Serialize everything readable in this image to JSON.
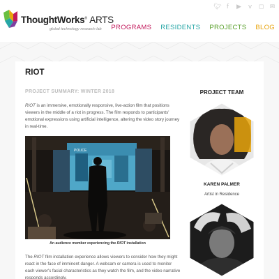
{
  "brand": {
    "name": "ThoughtWorks",
    "suffix": "ARTS",
    "tagline": "global technology research lab"
  },
  "social_icons": [
    "twitter-icon",
    "facebook-icon",
    "youtube-icon",
    "vimeo-icon",
    "instagram-icon",
    "email-icon"
  ],
  "nav": {
    "programs": "PROGRAMS",
    "residents": "RESIDENTS",
    "projects": "PROJECTS",
    "blog": "BLOG"
  },
  "colors": {
    "programs": "#c2185b",
    "residents": "#26a6a6",
    "projects": "#5aa02c",
    "blog": "#e8a40c"
  },
  "project": {
    "title": "RIOT",
    "summary_label": "PROJECT SUMMARY: WINTER 2018",
    "intro_em": "RIOT",
    "intro_rest": " is an immersive, emotionally responsive, live-action film that positions viewers in the middle of a riot in progress. The film responds to participants' emotional expressions using artificial intelligence, altering the video story journey in real-time.",
    "photo_sign": "POLICE",
    "caption_pre": "An audience member experiencing the ",
    "caption_em": "RIOT",
    "caption_post": " installation",
    "body_pre": "The ",
    "body_em": "RIOT",
    "body_rest": " film installation experience allows viewers to consider how they might react in the face of imminent danger. A webcam or camera is used to monitor each viewer's facial characteristics as they watch the film, and the video narrative responds accordingly."
  },
  "team": {
    "title": "PROJECT TEAM",
    "members": [
      {
        "name": "KAREN PALMER",
        "role": "Artist in Residence"
      },
      {
        "name": "",
        "role": ""
      }
    ]
  }
}
